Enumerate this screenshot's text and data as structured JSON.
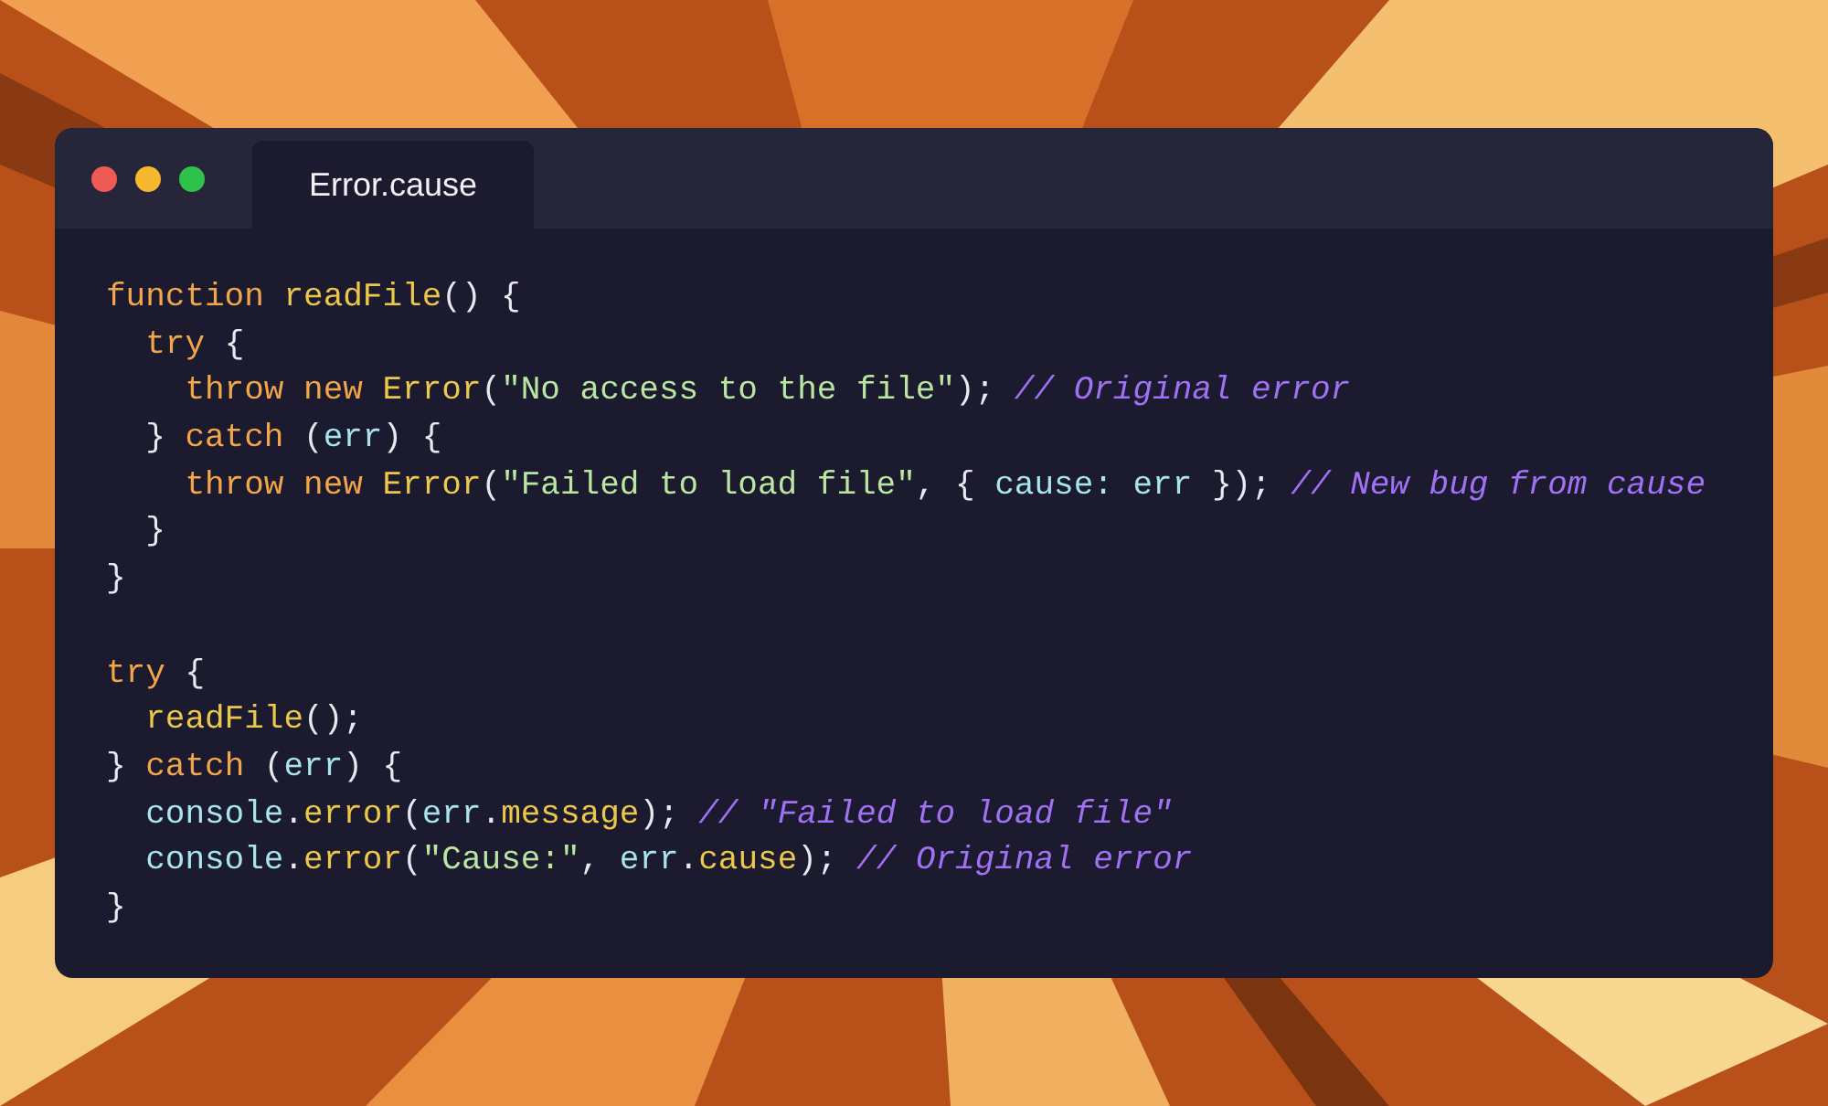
{
  "window": {
    "traffic_lights": [
      {
        "color": "#ef5a55"
      },
      {
        "color": "#f5b82e"
      },
      {
        "color": "#2fc14a"
      }
    ],
    "tabs": [
      {
        "label": "Error.cause",
        "selected": true
      }
    ]
  },
  "code": {
    "lines": [
      {
        "kind": "code",
        "tokens": [
          {
            "kind": "keyword",
            "text": "function "
          },
          {
            "kind": "function",
            "text": "readFile"
          },
          {
            "kind": "punctuation",
            "text": "() {"
          }
        ]
      },
      {
        "kind": "code",
        "tokens": [
          {
            "kind": "keyword",
            "text": "  try"
          },
          {
            "kind": "punctuation",
            "text": " {"
          }
        ]
      },
      {
        "kind": "code",
        "tokens": [
          {
            "kind": "keyword",
            "text": "    throw new "
          },
          {
            "kind": "function",
            "text": "Error"
          },
          {
            "kind": "punctuation",
            "text": "("
          },
          {
            "kind": "string",
            "text": "\"No access to the file\""
          },
          {
            "kind": "punctuation",
            "text": ");"
          },
          {
            "kind": "comment",
            "text": " // Original error"
          }
        ]
      },
      {
        "kind": "code",
        "tokens": [
          {
            "kind": "punctuation",
            "text": "  }"
          },
          {
            "kind": "keyword",
            "text": " catch"
          },
          {
            "kind": "punctuation",
            "text": " ("
          },
          {
            "kind": "variable",
            "text": "err"
          },
          {
            "kind": "punctuation",
            "text": ") {"
          }
        ]
      },
      {
        "kind": "code",
        "tokens": [
          {
            "kind": "keyword",
            "text": "    throw new "
          },
          {
            "kind": "function",
            "text": "Error"
          },
          {
            "kind": "punctuation",
            "text": "("
          },
          {
            "kind": "string",
            "text": "\"Failed to load file\""
          },
          {
            "kind": "punctuation",
            "text": ", { "
          },
          {
            "kind": "variable",
            "text": "cause: err"
          },
          {
            "kind": "punctuation",
            "text": " });"
          },
          {
            "kind": "comment",
            "text": " // New bug from cause"
          }
        ]
      },
      {
        "kind": "code",
        "tokens": [
          {
            "kind": "punctuation",
            "text": "  }"
          }
        ]
      },
      {
        "kind": "code",
        "tokens": [
          {
            "kind": "punctuation",
            "text": "}"
          }
        ]
      },
      {
        "kind": "blank"
      },
      {
        "kind": "code",
        "tokens": [
          {
            "kind": "keyword",
            "text": "try"
          },
          {
            "kind": "punctuation",
            "text": " {"
          }
        ]
      },
      {
        "kind": "code",
        "tokens": [
          {
            "kind": "function",
            "text": "  readFile"
          },
          {
            "kind": "punctuation",
            "text": "();"
          }
        ]
      },
      {
        "kind": "code",
        "tokens": [
          {
            "kind": "punctuation",
            "text": "}"
          },
          {
            "kind": "keyword",
            "text": " catch"
          },
          {
            "kind": "punctuation",
            "text": " ("
          },
          {
            "kind": "variable",
            "text": "err"
          },
          {
            "kind": "punctuation",
            "text": ") {"
          }
        ]
      },
      {
        "kind": "code",
        "tokens": [
          {
            "kind": "variable",
            "text": "  console"
          },
          {
            "kind": "punctuation",
            "text": "."
          },
          {
            "kind": "function",
            "text": "error"
          },
          {
            "kind": "punctuation",
            "text": "("
          },
          {
            "kind": "variable",
            "text": "err"
          },
          {
            "kind": "punctuation",
            "text": "."
          },
          {
            "kind": "function",
            "text": "message"
          },
          {
            "kind": "punctuation",
            "text": ");"
          },
          {
            "kind": "comment",
            "text": " // \"Failed to load file\""
          }
        ]
      },
      {
        "kind": "code",
        "tokens": [
          {
            "kind": "variable",
            "text": "  console"
          },
          {
            "kind": "punctuation",
            "text": "."
          },
          {
            "kind": "function",
            "text": "error"
          },
          {
            "kind": "punctuation",
            "text": "("
          },
          {
            "kind": "string",
            "text": "\"Cause:\""
          },
          {
            "kind": "punctuation",
            "text": ", "
          },
          {
            "kind": "variable",
            "text": "err"
          },
          {
            "kind": "punctuation",
            "text": "."
          },
          {
            "kind": "function",
            "text": "cause"
          },
          {
            "kind": "punctuation",
            "text": ");"
          },
          {
            "kind": "comment",
            "text": " // Original error"
          }
        ]
      },
      {
        "kind": "code",
        "tokens": [
          {
            "kind": "punctuation",
            "text": "}"
          }
        ]
      }
    ]
  }
}
